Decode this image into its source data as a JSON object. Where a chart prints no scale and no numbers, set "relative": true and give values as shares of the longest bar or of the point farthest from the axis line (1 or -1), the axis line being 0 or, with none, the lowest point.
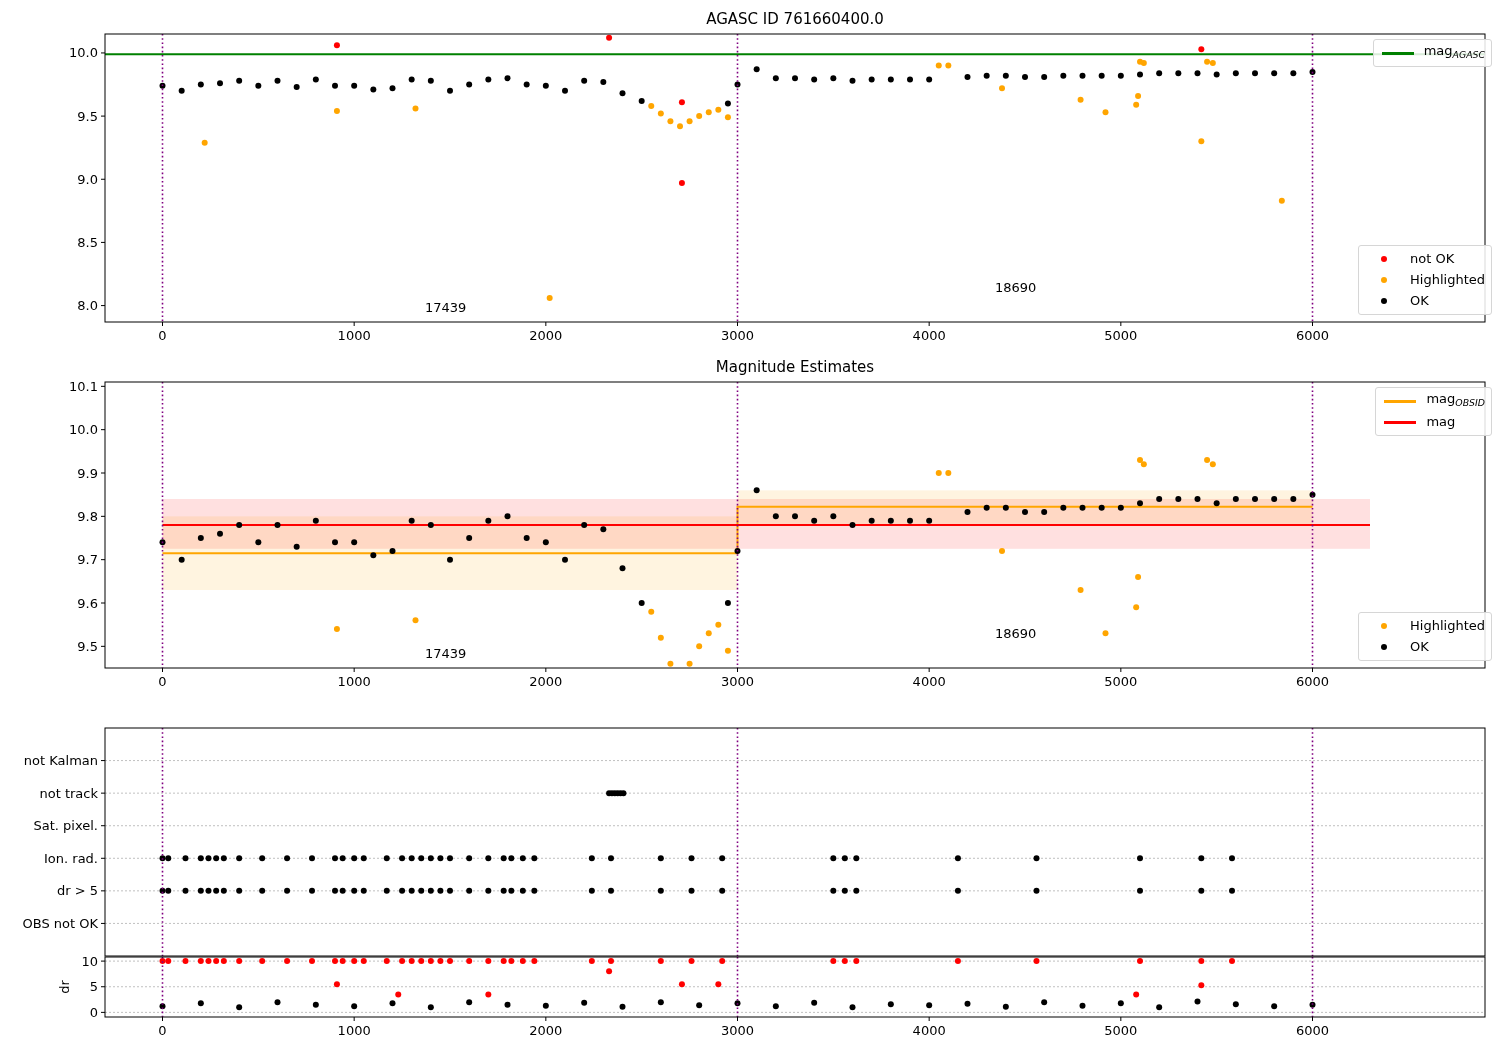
{
  "panels": [
    {
      "title": "AGASC ID 761660400.0",
      "charts": [
        {
          "chart_data": {
            "type": "scatter",
            "legend": [
              "upper right",
              "lower right"
            ],
            "xlim": [
              -300,
              6900
            ],
            "ylim": [
              7.87,
              10.15
            ],
            "xticks": [
              0,
              1000,
              2000,
              3000,
              4000,
              5000,
              6000
            ],
            "yticks": [
              {
                "value": 8,
                "label": "8.0"
              },
              {
                "value": 8.5,
                "label": "8.5"
              },
              {
                "value": 9,
                "label": "9.0"
              },
              {
                "value": 9.5,
                "label": "9.5"
              },
              {
                "value": 10,
                "label": "10.0"
              }
            ],
            "series": [
              {
                "name": "mag$_{AGASC}$",
                "type": "line",
                "color": "#008000",
                "x": [
                  -300,
                  6900
                ],
                "values": [
                  9.99,
                  9.99
                ]
              },
              {
                "name": "not OK",
                "type": "scatter",
                "color": "#ff0000",
                "x": [
                  910,
                  2330,
                  2710,
                  2710,
                  5420
                ],
                "values": [
                  10.06,
                  10.12,
                  9.61,
                  8.97,
                  10.03
                ]
              },
              {
                "name": "Highlighted",
                "type": "scatter",
                "color": "#ffa500",
                "x": [
                  220,
                  910,
                  1320,
                  2020,
                  2550,
                  2600,
                  2650,
                  2700,
                  2750,
                  2800,
                  2850,
                  2900,
                  2950,
                  4050,
                  4100,
                  4380,
                  4790,
                  4920,
                  5080,
                  5090,
                  5100,
                  5120,
                  5420,
                  5450,
                  5480,
                  5840
                ],
                "values": [
                  9.29,
                  9.54,
                  9.56,
                  8.06,
                  9.58,
                  9.52,
                  9.46,
                  9.42,
                  9.46,
                  9.5,
                  9.53,
                  9.55,
                  9.49,
                  9.9,
                  9.9,
                  9.72,
                  9.63,
                  9.53,
                  9.59,
                  9.66,
                  9.93,
                  9.92,
                  9.3,
                  9.93,
                  9.92,
                  8.83
                ]
              },
              {
                "name": "OK",
                "type": "scatter",
                "color": "#000000",
                "x": [
                  0,
                  100,
                  200,
                  300,
                  400,
                  500,
                  600,
                  700,
                  800,
                  900,
                  1000,
                  1100,
                  1200,
                  1300,
                  1400,
                  1500,
                  1600,
                  1700,
                  1800,
                  1900,
                  2000,
                  2100,
                  2200,
                  2300,
                  2400,
                  2500,
                  2950,
                  3000,
                  3100,
                  3200,
                  3300,
                  3400,
                  3500,
                  3600,
                  3700,
                  3800,
                  3900,
                  4000,
                  4200,
                  4300,
                  4400,
                  4500,
                  4600,
                  4700,
                  4800,
                  4900,
                  5000,
                  5100,
                  5200,
                  5300,
                  5400,
                  5500,
                  5600,
                  5700,
                  5800,
                  5900,
                  6000
                ],
                "values": [
                  9.74,
                  9.7,
                  9.75,
                  9.76,
                  9.78,
                  9.74,
                  9.78,
                  9.73,
                  9.79,
                  9.74,
                  9.74,
                  9.71,
                  9.72,
                  9.79,
                  9.78,
                  9.7,
                  9.75,
                  9.79,
                  9.8,
                  9.75,
                  9.74,
                  9.7,
                  9.78,
                  9.77,
                  9.68,
                  9.62,
                  9.6,
                  9.75,
                  9.87,
                  9.8,
                  9.8,
                  9.79,
                  9.8,
                  9.78,
                  9.79,
                  9.79,
                  9.79,
                  9.79,
                  9.81,
                  9.82,
                  9.82,
                  9.81,
                  9.81,
                  9.82,
                  9.82,
                  9.82,
                  9.82,
                  9.83,
                  9.84,
                  9.84,
                  9.84,
                  9.83,
                  9.84,
                  9.84,
                  9.84,
                  9.84,
                  9.85
                ]
              }
            ],
            "ref_lines": [
              {
                "axis": "x",
                "value": 0
              },
              {
                "axis": "x",
                "value": 3000
              },
              {
                "axis": "x",
                "value": 6000
              }
            ],
            "annotations": [
              "17439",
              "18690"
            ]
          }
        }
      ]
    },
    {
      "title": "Magnitude Estimates",
      "charts": [
        {
          "chart_data": {
            "type": "scatter",
            "legend": [
              "upper right",
              "lower right"
            ],
            "xlim": [
              -300,
              6900
            ],
            "ylim": [
              9.45,
              10.11
            ],
            "xticks": [
              0,
              1000,
              2000,
              3000,
              4000,
              5000,
              6000
            ],
            "yticks": [
              {
                "value": 9.5,
                "label": "9.5"
              },
              {
                "value": 9.6,
                "label": "9.6"
              },
              {
                "value": 9.7,
                "label": "9.7"
              },
              {
                "value": 9.8,
                "label": "9.8"
              },
              {
                "value": 9.9,
                "label": "9.9"
              },
              {
                "value": 10,
                "label": "10.0"
              },
              {
                "value": 10.1,
                "label": "10.1"
              }
            ],
            "series": [
              {
                "name": "mag$_{OBSID}$",
                "type": "line",
                "color": "#ffa500",
                "x": [
                  0,
                  3000,
                  3000,
                  6000
                ],
                "values": [
                  9.715,
                  9.715,
                  9.822,
                  9.822
                ]
              },
              {
                "name": "mag",
                "type": "line",
                "color": "#ff0000",
                "x": [
                  0,
                  6300
                ],
                "values": [
                  9.78,
                  9.78
                ]
              },
              {
                "name": "Highlighted",
                "type": "scatter",
                "color": "#ffa500",
                "x": [
                  910,
                  1320,
                  2550,
                  2600,
                  2650,
                  2750,
                  2800,
                  2850,
                  2900,
                  2950,
                  4050,
                  4100,
                  4380,
                  4790,
                  4920,
                  5080,
                  5090,
                  5100,
                  5120,
                  5450,
                  5480
                ],
                "values": [
                  9.54,
                  9.56,
                  9.58,
                  9.52,
                  9.46,
                  9.46,
                  9.5,
                  9.53,
                  9.55,
                  9.49,
                  9.9,
                  9.9,
                  9.72,
                  9.63,
                  9.53,
                  9.59,
                  9.66,
                  9.93,
                  9.92,
                  9.93,
                  9.92
                ]
              },
              {
                "name": "OK",
                "type": "scatter",
                "color": "#000000",
                "x": [
                  0,
                  100,
                  200,
                  300,
                  400,
                  500,
                  600,
                  700,
                  800,
                  900,
                  1000,
                  1100,
                  1200,
                  1300,
                  1400,
                  1500,
                  1600,
                  1700,
                  1800,
                  1900,
                  2000,
                  2100,
                  2200,
                  2300,
                  2400,
                  2500,
                  2950,
                  3000,
                  3100,
                  3200,
                  3300,
                  3400,
                  3500,
                  3600,
                  3700,
                  3800,
                  3900,
                  4000,
                  4200,
                  4300,
                  4400,
                  4500,
                  4600,
                  4700,
                  4800,
                  4900,
                  5000,
                  5100,
                  5200,
                  5300,
                  5400,
                  5500,
                  5600,
                  5700,
                  5800,
                  5900,
                  6000
                ],
                "values": [
                  9.74,
                  9.7,
                  9.75,
                  9.76,
                  9.78,
                  9.74,
                  9.78,
                  9.73,
                  9.79,
                  9.74,
                  9.74,
                  9.71,
                  9.72,
                  9.79,
                  9.78,
                  9.7,
                  9.75,
                  9.79,
                  9.8,
                  9.75,
                  9.74,
                  9.7,
                  9.78,
                  9.77,
                  9.68,
                  9.6,
                  9.6,
                  9.72,
                  9.86,
                  9.8,
                  9.8,
                  9.79,
                  9.8,
                  9.78,
                  9.79,
                  9.79,
                  9.79,
                  9.79,
                  9.81,
                  9.82,
                  9.82,
                  9.81,
                  9.81,
                  9.82,
                  9.82,
                  9.82,
                  9.82,
                  9.83,
                  9.84,
                  9.84,
                  9.84,
                  9.83,
                  9.84,
                  9.84,
                  9.84,
                  9.84,
                  9.85
                ]
              }
            ],
            "bands": [
              {
                "axis": "y",
                "from": 9.725,
                "to": 9.84,
                "color": "#ff0000"
              },
              {
                "axis": "y",
                "from": 9.63,
                "to": 9.8,
                "color": "#ffa500"
              },
              {
                "axis": "y",
                "from": 9.78,
                "to": 9.86,
                "color": "#ffa500"
              }
            ],
            "ref_lines": [
              {
                "axis": "x",
                "value": 0
              },
              {
                "axis": "x",
                "value": 3000
              },
              {
                "axis": "x",
                "value": 6000
              }
            ],
            "annotations": [
              "17439",
              "18690"
            ]
          }
        }
      ]
    },
    {
      "charts": [
        {
          "chart_data": {
            "type": "scatter",
            "grid": true,
            "relative": true,
            "orientation": "horizontal",
            "xlim": [
              -300,
              6900
            ],
            "categories": [
              "not Kalman",
              "not track",
              "Sat. pixel.",
              "Ion. rad.",
              "dr > 5",
              "OBS not OK"
            ],
            "series": [
              {
                "type": "scatter",
                "color": "#000000",
                "values": [
                  null,
                  2330,
                  null,
                  null,
                  null,
                  null
                ]
              },
              {
                "type": "scatter",
                "color": "#000000",
                "values": [
                  null,
                  2345,
                  null,
                  null,
                  null,
                  null
                ]
              },
              {
                "type": "scatter",
                "color": "#000000",
                "values": [
                  null,
                  2360,
                  null,
                  null,
                  null,
                  null
                ]
              },
              {
                "type": "scatter",
                "color": "#000000",
                "values": [
                  null,
                  2375,
                  null,
                  null,
                  null,
                  null
                ]
              },
              {
                "type": "scatter",
                "color": "#000000",
                "values": [
                  null,
                  2390,
                  null,
                  null,
                  null,
                  null
                ]
              },
              {
                "type": "scatter",
                "color": "#000000",
                "values": [
                  null,
                  2405,
                  null,
                  null,
                  null,
                  null
                ]
              },
              {
                "type": "scatter",
                "color": "#000000",
                "values": [
                  null,
                  null,
                  null,
                  0,
                  0,
                  null
                ]
              },
              {
                "type": "scatter",
                "color": "#000000",
                "values": [
                  null,
                  null,
                  null,
                  30,
                  30,
                  null
                ]
              },
              {
                "type": "scatter",
                "color": "#000000",
                "values": [
                  null,
                  null,
                  null,
                  120,
                  120,
                  null
                ]
              },
              {
                "type": "scatter",
                "color": "#000000",
                "values": [
                  null,
                  null,
                  null,
                  200,
                  200,
                  null
                ]
              },
              {
                "type": "scatter",
                "color": "#000000",
                "values": [
                  null,
                  null,
                  null,
                  240,
                  240,
                  null
                ]
              },
              {
                "type": "scatter",
                "color": "#000000",
                "values": [
                  null,
                  null,
                  null,
                  280,
                  280,
                  null
                ]
              },
              {
                "type": "scatter",
                "color": "#000000",
                "values": [
                  null,
                  null,
                  null,
                  320,
                  320,
                  null
                ]
              },
              {
                "type": "scatter",
                "color": "#000000",
                "values": [
                  null,
                  null,
                  null,
                  400,
                  400,
                  null
                ]
              },
              {
                "type": "scatter",
                "color": "#000000",
                "values": [
                  null,
                  null,
                  null,
                  520,
                  520,
                  null
                ]
              },
              {
                "type": "scatter",
                "color": "#000000",
                "values": [
                  null,
                  null,
                  null,
                  650,
                  650,
                  null
                ]
              },
              {
                "type": "scatter",
                "color": "#000000",
                "values": [
                  null,
                  null,
                  null,
                  780,
                  780,
                  null
                ]
              },
              {
                "type": "scatter",
                "color": "#000000",
                "values": [
                  null,
                  null,
                  null,
                  900,
                  900,
                  null
                ]
              },
              {
                "type": "scatter",
                "color": "#000000",
                "values": [
                  null,
                  null,
                  null,
                  940,
                  940,
                  null
                ]
              },
              {
                "type": "scatter",
                "color": "#000000",
                "values": [
                  null,
                  null,
                  null,
                  1000,
                  1000,
                  null
                ]
              },
              {
                "type": "scatter",
                "color": "#000000",
                "values": [
                  null,
                  null,
                  null,
                  1050,
                  1050,
                  null
                ]
              },
              {
                "type": "scatter",
                "color": "#000000",
                "values": [
                  null,
                  null,
                  null,
                  1170,
                  1170,
                  null
                ]
              },
              {
                "type": "scatter",
                "color": "#000000",
                "values": [
                  null,
                  null,
                  null,
                  1250,
                  1250,
                  null
                ]
              },
              {
                "type": "scatter",
                "color": "#000000",
                "values": [
                  null,
                  null,
                  null,
                  1300,
                  1300,
                  null
                ]
              },
              {
                "type": "scatter",
                "color": "#000000",
                "values": [
                  null,
                  null,
                  null,
                  1350,
                  1350,
                  null
                ]
              },
              {
                "type": "scatter",
                "color": "#000000",
                "values": [
                  null,
                  null,
                  null,
                  1400,
                  1400,
                  null
                ]
              },
              {
                "type": "scatter",
                "color": "#000000",
                "values": [
                  null,
                  null,
                  null,
                  1450,
                  1450,
                  null
                ]
              },
              {
                "type": "scatter",
                "color": "#000000",
                "values": [
                  null,
                  null,
                  null,
                  1500,
                  1500,
                  null
                ]
              },
              {
                "type": "scatter",
                "color": "#000000",
                "values": [
                  null,
                  null,
                  null,
                  1600,
                  1600,
                  null
                ]
              },
              {
                "type": "scatter",
                "color": "#000000",
                "values": [
                  null,
                  null,
                  null,
                  1700,
                  1700,
                  null
                ]
              },
              {
                "type": "scatter",
                "color": "#000000",
                "values": [
                  null,
                  null,
                  null,
                  1780,
                  1780,
                  null
                ]
              },
              {
                "type": "scatter",
                "color": "#000000",
                "values": [
                  null,
                  null,
                  null,
                  1820,
                  1820,
                  null
                ]
              },
              {
                "type": "scatter",
                "color": "#000000",
                "values": [
                  null,
                  null,
                  null,
                  1880,
                  1880,
                  null
                ]
              },
              {
                "type": "scatter",
                "color": "#000000",
                "values": [
                  null,
                  null,
                  null,
                  1940,
                  1940,
                  null
                ]
              },
              {
                "type": "scatter",
                "color": "#000000",
                "values": [
                  null,
                  null,
                  null,
                  2240,
                  2240,
                  null
                ]
              },
              {
                "type": "scatter",
                "color": "#000000",
                "values": [
                  null,
                  null,
                  null,
                  2340,
                  2340,
                  null
                ]
              },
              {
                "type": "scatter",
                "color": "#000000",
                "values": [
                  null,
                  null,
                  null,
                  2600,
                  2600,
                  null
                ]
              },
              {
                "type": "scatter",
                "color": "#000000",
                "values": [
                  null,
                  null,
                  null,
                  2760,
                  2760,
                  null
                ]
              },
              {
                "type": "scatter",
                "color": "#000000",
                "values": [
                  null,
                  null,
                  null,
                  2920,
                  2920,
                  null
                ]
              },
              {
                "type": "scatter",
                "color": "#000000",
                "values": [
                  null,
                  null,
                  null,
                  3500,
                  3500,
                  null
                ]
              },
              {
                "type": "scatter",
                "color": "#000000",
                "values": [
                  null,
                  null,
                  null,
                  3560,
                  3560,
                  null
                ]
              },
              {
                "type": "scatter",
                "color": "#000000",
                "values": [
                  null,
                  null,
                  null,
                  3620,
                  3620,
                  null
                ]
              },
              {
                "type": "scatter",
                "color": "#000000",
                "values": [
                  null,
                  null,
                  null,
                  4150,
                  4150,
                  null
                ]
              },
              {
                "type": "scatter",
                "color": "#000000",
                "values": [
                  null,
                  null,
                  null,
                  4560,
                  4560,
                  null
                ]
              },
              {
                "type": "scatter",
                "color": "#000000",
                "values": [
                  null,
                  null,
                  null,
                  5100,
                  5100,
                  null
                ]
              },
              {
                "type": "scatter",
                "color": "#000000",
                "values": [
                  null,
                  null,
                  null,
                  5420,
                  5420,
                  null
                ]
              },
              {
                "type": "scatter",
                "color": "#000000",
                "values": [
                  null,
                  null,
                  null,
                  5580,
                  5580,
                  null
                ]
              }
            ],
            "ref_lines": [
              {
                "axis": "x",
                "value": 0
              },
              {
                "axis": "x",
                "value": 3000
              },
              {
                "axis": "x",
                "value": 6000
              }
            ]
          }
        },
        {
          "chart_data": {
            "type": "scatter",
            "grid": true,
            "ylabel": "dr",
            "xlim": [
              -300,
              6900
            ],
            "ylim": [
              -0.9,
              10.8
            ],
            "xticks": [
              0,
              1000,
              2000,
              3000,
              4000,
              5000,
              6000
            ],
            "yticks": [
              0,
              5,
              10
            ],
            "series": [
              {
                "type": "scatter",
                "color": "#000000",
                "x": [
                  0,
                  200,
                  400,
                  600,
                  800,
                  1000,
                  1200,
                  1400,
                  1600,
                  1800,
                  2000,
                  2200,
                  2400,
                  2600,
                  2800,
                  3000,
                  3200,
                  3400,
                  3600,
                  3800,
                  4000,
                  4200,
                  4400,
                  4600,
                  4800,
                  5000,
                  5200,
                  5400,
                  5600,
                  5800,
                  6000
                ],
                "values": [
                  1.2,
                  1.8,
                  1,
                  2,
                  1.5,
                  1.2,
                  1.8,
                  1,
                  2,
                  1.5,
                  1.3,
                  1.9,
                  1.1,
                  2,
                  1.4,
                  1.8,
                  1.2,
                  1.9,
                  1,
                  1.6,
                  1.4,
                  1.7,
                  1.1,
                  2,
                  1.3,
                  1.8,
                  1,
                  2.1,
                  1.6,
                  1.2,
                  1.5
                ]
              },
              {
                "type": "scatter",
                "color": "#ff0000",
                "x": [
                  0,
                  30,
                  120,
                  200,
                  240,
                  280,
                  320,
                  400,
                  520,
                  650,
                  780,
                  900,
                  940,
                  1000,
                  1050,
                  1170,
                  1250,
                  1300,
                  1350,
                  1400,
                  1450,
                  1500,
                  1600,
                  1700,
                  1780,
                  1820,
                  1880,
                  1940,
                  2240,
                  2340,
                  2600,
                  2760,
                  2920,
                  3500,
                  3560,
                  3620,
                  4150,
                  4560,
                  5100,
                  5420,
                  5580,
                  910,
                  2330,
                  2710,
                  2900,
                  5420,
                  1230,
                  1700,
                  5080
                ],
                "values": [
                  10,
                  10,
                  10,
                  10,
                  10,
                  10,
                  10,
                  10,
                  10,
                  10,
                  10,
                  10,
                  10,
                  10,
                  10,
                  10,
                  10,
                  10,
                  10,
                  10,
                  10,
                  10,
                  10,
                  10,
                  10,
                  10,
                  10,
                  10,
                  10,
                  10,
                  10,
                  10,
                  10,
                  10,
                  10,
                  10,
                  10,
                  10,
                  10,
                  10,
                  10,
                  5.5,
                  8,
                  5.5,
                  5.5,
                  5.3,
                  3.5,
                  3.5,
                  3.5
                ]
              }
            ],
            "ref_lines": [
              {
                "axis": "x",
                "value": 0
              },
              {
                "axis": "x",
                "value": 3000
              },
              {
                "axis": "x",
                "value": 6000
              }
            ]
          }
        }
      ]
    }
  ]
}
